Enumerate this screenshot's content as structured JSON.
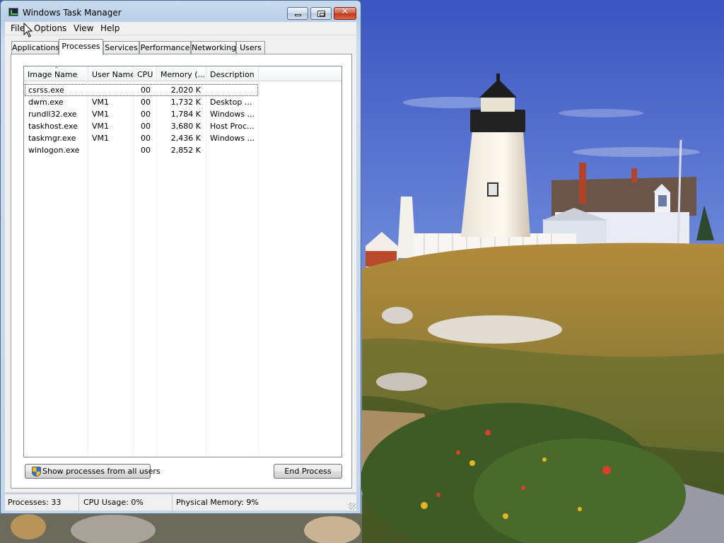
{
  "window": {
    "title": "Windows Task Manager",
    "close_glyph": "✕"
  },
  "menu": [
    "File",
    "Options",
    "View",
    "Help"
  ],
  "tabs": [
    "Applications",
    "Processes",
    "Services",
    "Performance",
    "Networking",
    "Users"
  ],
  "active_tab": "Processes",
  "columns": [
    "Image Name",
    "User Name",
    "CPU",
    "Memory (...",
    "Description"
  ],
  "sort_indicator": "^",
  "processes": [
    {
      "image": "csrss.exe",
      "user": "",
      "cpu": "00",
      "memory": "2,020 K",
      "description": ""
    },
    {
      "image": "dwm.exe",
      "user": "VM1",
      "cpu": "00",
      "memory": "1,732 K",
      "description": "Desktop ..."
    },
    {
      "image": "rundll32.exe",
      "user": "VM1",
      "cpu": "00",
      "memory": "1,784 K",
      "description": "Windows ..."
    },
    {
      "image": "taskhost.exe",
      "user": "VM1",
      "cpu": "00",
      "memory": "3,680 K",
      "description": "Host Proc..."
    },
    {
      "image": "taskmgr.exe",
      "user": "VM1",
      "cpu": "00",
      "memory": "2,436 K",
      "description": "Windows ..."
    },
    {
      "image": "winlogon.exe",
      "user": "",
      "cpu": "00",
      "memory": "2,852 K",
      "description": ""
    }
  ],
  "buttons": {
    "show_all": "Show processes from all users",
    "end_process": "End Process"
  },
  "status": {
    "processes": "Processes: 33",
    "cpu": "CPU Usage: 0%",
    "memory": "Physical Memory: 9%"
  },
  "colors": {
    "selection_border": "#444444",
    "window_frame": "#b9cfe7",
    "close_button": "#c2391c"
  }
}
